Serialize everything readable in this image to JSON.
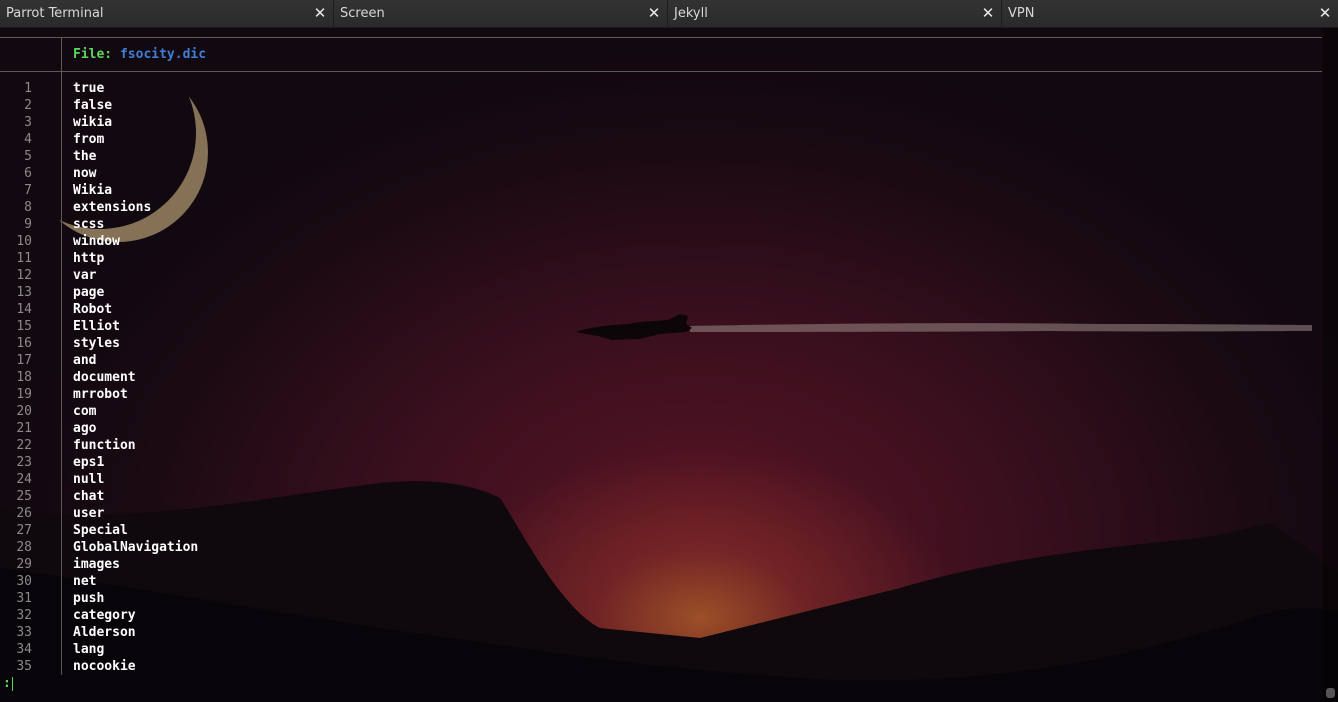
{
  "tabs": [
    {
      "label": "Parrot Terminal",
      "close_icon": "close-icon"
    },
    {
      "label": "Screen",
      "close_icon": "close-icon"
    },
    {
      "label": "Jekyll",
      "close_icon": "close-icon"
    },
    {
      "label": "VPN",
      "close_icon": "close-icon"
    }
  ],
  "close_glyph": "✕",
  "viewer": {
    "file_label": "File: ",
    "file_name": "fsocity.dic",
    "lines": [
      {
        "n": "1",
        "text": "true"
      },
      {
        "n": "2",
        "text": "false"
      },
      {
        "n": "3",
        "text": "wikia"
      },
      {
        "n": "4",
        "text": "from"
      },
      {
        "n": "5",
        "text": "the"
      },
      {
        "n": "6",
        "text": "now"
      },
      {
        "n": "7",
        "text": "Wikia"
      },
      {
        "n": "8",
        "text": "extensions"
      },
      {
        "n": "9",
        "text": "scss"
      },
      {
        "n": "10",
        "text": "window"
      },
      {
        "n": "11",
        "text": "http"
      },
      {
        "n": "12",
        "text": "var"
      },
      {
        "n": "13",
        "text": "page"
      },
      {
        "n": "14",
        "text": "Robot"
      },
      {
        "n": "15",
        "text": "Elliot"
      },
      {
        "n": "16",
        "text": "styles"
      },
      {
        "n": "17",
        "text": "and"
      },
      {
        "n": "18",
        "text": "document"
      },
      {
        "n": "19",
        "text": "mrrobot"
      },
      {
        "n": "20",
        "text": "com"
      },
      {
        "n": "21",
        "text": "ago"
      },
      {
        "n": "22",
        "text": "function"
      },
      {
        "n": "23",
        "text": "eps1"
      },
      {
        "n": "24",
        "text": "null"
      },
      {
        "n": "25",
        "text": "chat"
      },
      {
        "n": "26",
        "text": "user"
      },
      {
        "n": "27",
        "text": "Special"
      },
      {
        "n": "28",
        "text": "GlobalNavigation"
      },
      {
        "n": "29",
        "text": "images"
      },
      {
        "n": "30",
        "text": "net"
      },
      {
        "n": "31",
        "text": "push"
      },
      {
        "n": "32",
        "text": "category"
      },
      {
        "n": "33",
        "text": "Alderson"
      },
      {
        "n": "34",
        "text": "lang"
      },
      {
        "n": "35",
        "text": "nocookie"
      }
    ],
    "prompt": ":"
  },
  "colors": {
    "file_label": "#5bd75b",
    "file_name": "#3f7fd6",
    "line_text": "#ffffff",
    "line_number": "#8a8a8a"
  },
  "wallpaper": {
    "elements": [
      "crescent-moon",
      "jet-silhouette",
      "contrail",
      "mountains",
      "sunset-glow"
    ]
  }
}
